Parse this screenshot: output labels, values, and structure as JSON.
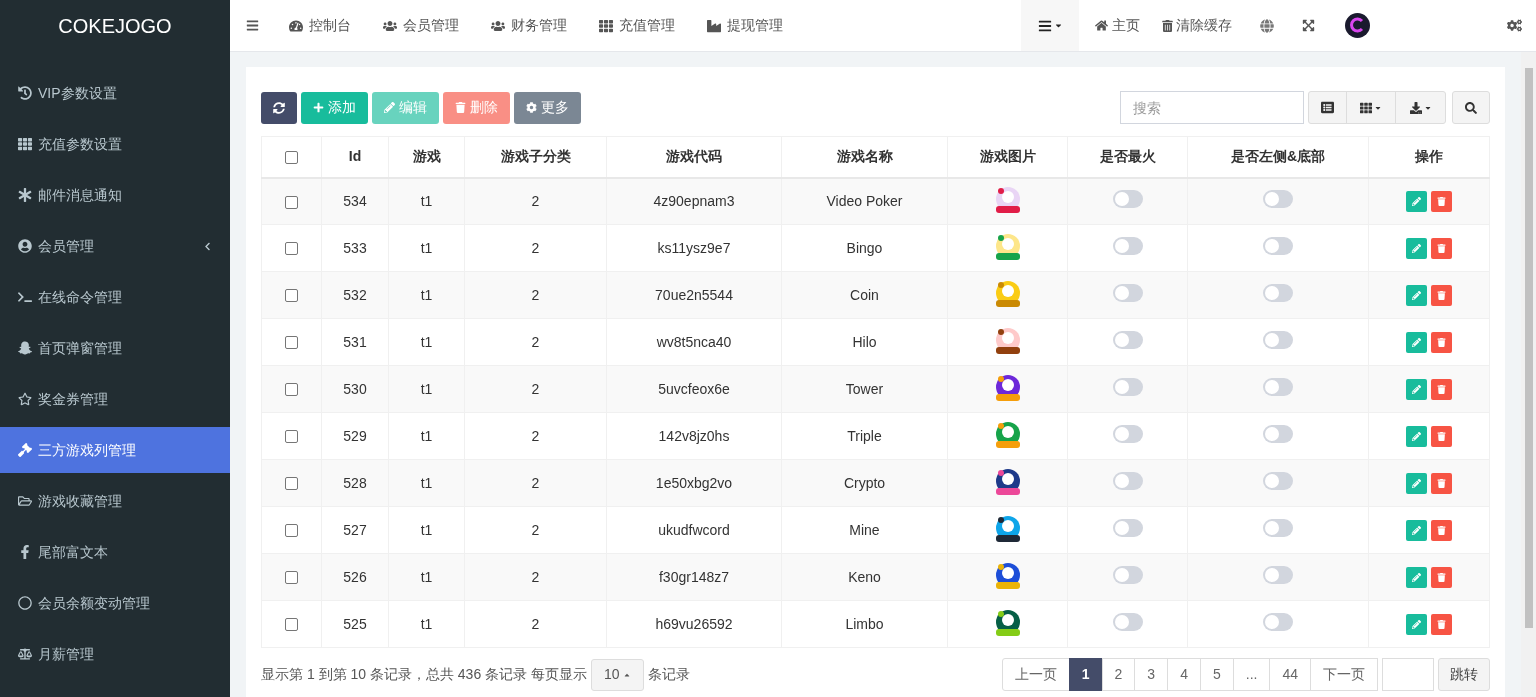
{
  "brand": "COKEJOGO",
  "sidebar": {
    "items": [
      {
        "label": "VIP参数设置",
        "selected": false,
        "expandable": false
      },
      {
        "label": "充值参数设置",
        "selected": false,
        "expandable": false
      },
      {
        "label": "邮件消息通知",
        "selected": false,
        "expandable": false
      },
      {
        "label": "会员管理",
        "selected": false,
        "expandable": true
      },
      {
        "label": "在线命令管理",
        "selected": false,
        "expandable": false
      },
      {
        "label": "首页弹窗管理",
        "selected": false,
        "expandable": false
      },
      {
        "label": "奖金券管理",
        "selected": false,
        "expandable": false
      },
      {
        "label": "三方游戏列管理",
        "selected": true,
        "expandable": false
      },
      {
        "label": "游戏收藏管理",
        "selected": false,
        "expandable": false
      },
      {
        "label": "尾部富文本",
        "selected": false,
        "expandable": false
      },
      {
        "label": "会员余额变动管理",
        "selected": false,
        "expandable": false
      },
      {
        "label": "月薪管理",
        "selected": false,
        "expandable": false
      }
    ]
  },
  "topnav": {
    "items": [
      "控制台",
      "会员管理",
      "财务管理",
      "充值管理",
      "提现管理"
    ],
    "right": [
      "主页",
      "清除缓存"
    ]
  },
  "toolbar": {
    "buttons": [
      {
        "label": "添加",
        "kind": "add",
        "disabled": false
      },
      {
        "label": "编辑",
        "kind": "edit",
        "disabled": true
      },
      {
        "label": "删除",
        "kind": "delete",
        "disabled": true
      },
      {
        "label": "更多",
        "kind": "more",
        "disabled": false
      }
    ],
    "search": {
      "placeholder": "搜索"
    }
  },
  "table": {
    "all_checked": false,
    "columns": [
      "Id",
      "游戏",
      "游戏子分类",
      "游戏代码",
      "游戏名称",
      "游戏图片",
      "是否最火",
      "是否左侧&底部",
      "操作"
    ],
    "rows": [
      {
        "checked": false,
        "id": "534",
        "game": "t1",
        "sub": "2",
        "code": "4z90epnam3",
        "name": "Video Poker",
        "hot": false,
        "left": false
      },
      {
        "checked": false,
        "id": "533",
        "game": "t1",
        "sub": "2",
        "code": "ks11ysz9e7",
        "name": "Bingo",
        "hot": false,
        "left": false
      },
      {
        "checked": false,
        "id": "532",
        "game": "t1",
        "sub": "2",
        "code": "70ue2n5544",
        "name": "Coin",
        "hot": false,
        "left": false
      },
      {
        "checked": false,
        "id": "531",
        "game": "t1",
        "sub": "2",
        "code": "wv8t5nca40",
        "name": "Hilo",
        "hot": false,
        "left": false
      },
      {
        "checked": false,
        "id": "530",
        "game": "t1",
        "sub": "2",
        "code": "5uvcfeox6e",
        "name": "Tower",
        "hot": false,
        "left": false
      },
      {
        "checked": false,
        "id": "529",
        "game": "t1",
        "sub": "2",
        "code": "142v8jz0hs",
        "name": "Triple",
        "hot": false,
        "left": false
      },
      {
        "checked": false,
        "id": "528",
        "game": "t1",
        "sub": "2",
        "code": "1e50xbg2vo",
        "name": "Crypto",
        "hot": false,
        "left": false
      },
      {
        "checked": false,
        "id": "527",
        "game": "t1",
        "sub": "2",
        "code": "ukudfwcord",
        "name": "Mine",
        "hot": false,
        "left": false
      },
      {
        "checked": false,
        "id": "526",
        "game": "t1",
        "sub": "2",
        "code": "f30gr148z7",
        "name": "Keno",
        "hot": false,
        "left": false
      },
      {
        "checked": false,
        "id": "525",
        "game": "t1",
        "sub": "2",
        "code": "h69vu26592",
        "name": "Limbo",
        "hot": false,
        "left": false
      }
    ]
  },
  "footer": {
    "summary_before": "显示第 1 到第 10 条记录，总共 436 条记录 每页显示",
    "page_size": "10",
    "summary_after": "条记录",
    "pagination": [
      {
        "label": "上一页",
        "selected": false
      },
      {
        "label": "1",
        "selected": true
      },
      {
        "label": "2",
        "selected": false
      },
      {
        "label": "3",
        "selected": false
      },
      {
        "label": "4",
        "selected": false
      },
      {
        "label": "5",
        "selected": false
      },
      {
        "label": "...",
        "selected": false
      },
      {
        "label": "44",
        "selected": false
      },
      {
        "label": "下一页",
        "selected": false
      }
    ],
    "jump": "跳转"
  }
}
